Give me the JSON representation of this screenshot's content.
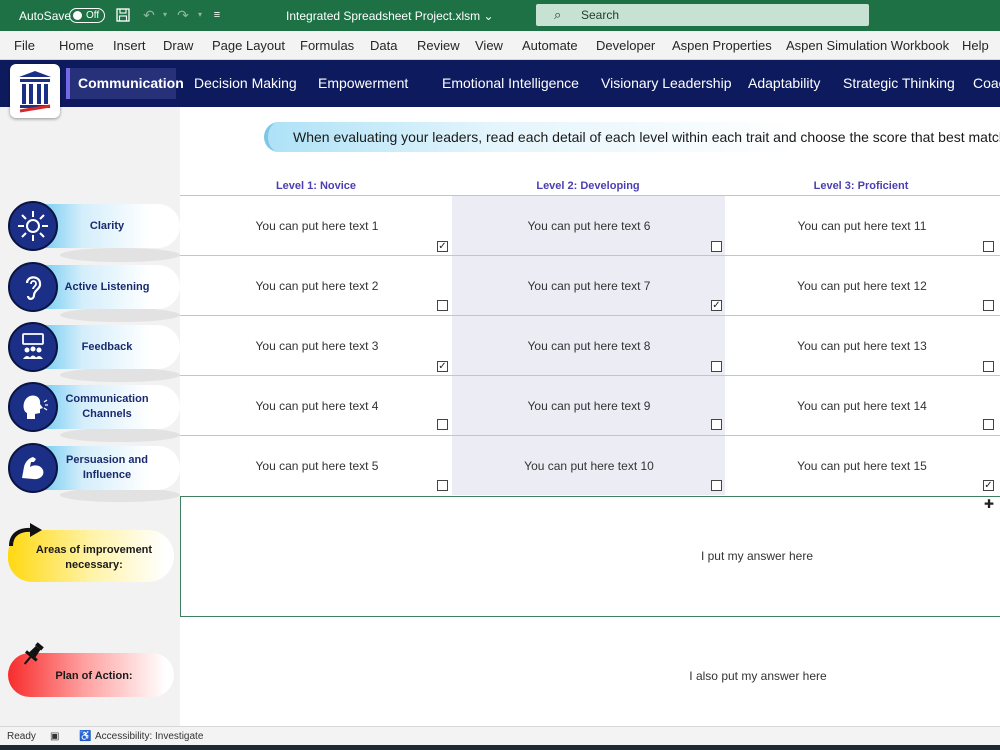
{
  "titlebar": {
    "autosave_label": "AutoSave",
    "autosave_state": "Off",
    "filename": "Integrated Spreadsheet Project.xlsm",
    "search_placeholder": "Search",
    "save_icon": "save-icon",
    "undo_icon": "undo-icon",
    "redo_icon": "redo-icon"
  },
  "menu": [
    "File",
    "Home",
    "Insert",
    "Draw",
    "Page Layout",
    "Formulas",
    "Data",
    "Review",
    "View",
    "Automate",
    "Developer",
    "Aspen Properties",
    "Aspen Simulation Workbook",
    "Help"
  ],
  "nav": {
    "tabs": [
      "Communication",
      "Decision Making",
      "Empowerment",
      "Emotional Intelligence",
      "Visionary Leadership",
      "Adaptability",
      "Strategic Thinking",
      "Coac"
    ],
    "active": "Communication",
    "accent": "#0d1b5e"
  },
  "instruction": "When evaluating your leaders, read each detail of each level within each trait and choose the score that best matches yo",
  "levels": [
    "Level 1: Novice",
    "Level 2: Developing",
    "Level 3: Proficient"
  ],
  "traits": [
    {
      "label": "Clarity",
      "icon": "sun-icon",
      "cells": [
        "You can put here text 1",
        "You can put here text 6",
        "You can put here text 11"
      ],
      "checked": [
        true,
        false,
        false
      ]
    },
    {
      "label": "Active Listening",
      "icon": "ear-icon",
      "cells": [
        "You can put here text 2",
        "You can put here text 7",
        "You can put here text 12"
      ],
      "checked": [
        false,
        true,
        false
      ]
    },
    {
      "label": "Feedback",
      "icon": "feedback-icon",
      "cells": [
        "You can put here text 3",
        "You can put here text 8",
        "You can put here text 13"
      ],
      "checked": [
        true,
        false,
        false
      ]
    },
    {
      "label": "Communication Channels",
      "icon": "speaking-head-icon",
      "cells": [
        "You can put here text 4",
        "You can put here text 9",
        "You can put here text 14"
      ],
      "checked": [
        false,
        false,
        false
      ]
    },
    {
      "label": "Persuasion and Influence",
      "icon": "flexed-arm-icon",
      "cells": [
        "You can put here text 5",
        "You can put here text 10",
        "You can put here text 15"
      ],
      "checked": [
        false,
        false,
        true
      ]
    }
  ],
  "improvement": {
    "label": "Areas of improvement necessary:",
    "answer": "I put my answer here",
    "icon": "curved-arrow-icon"
  },
  "plan": {
    "label": "Plan of Action:",
    "answer": "I also put my answer here",
    "icon": "pushpin-icon"
  },
  "status": {
    "ready": "Ready",
    "accessibility": "Accessibility: Investigate"
  }
}
